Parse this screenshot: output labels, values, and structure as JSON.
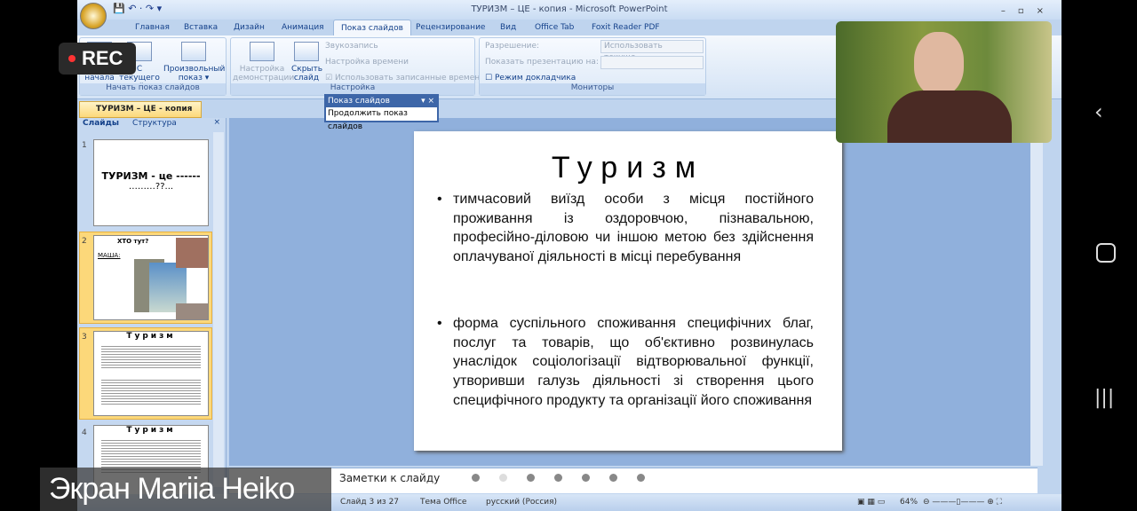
{
  "window": {
    "title": "ТУРИЗМ – ЦЕ - копия - Microsoft PowerPoint"
  },
  "tabs": [
    "Главная",
    "Вставка",
    "Дизайн",
    "Анимация",
    "Показ слайдов",
    "Рецензирование",
    "Вид",
    "Office Tab",
    "Foxit Reader PDF"
  ],
  "active_tab": "Показ слайдов",
  "ribbon": {
    "start_group": {
      "label": "Начать показ слайдов",
      "from_start": "С\nначала",
      "from_current": "С текущего слайда",
      "custom": "Произвольный показ ▾"
    },
    "setup_group": {
      "label": "Настройка",
      "setup": "Настройка демонстрации",
      "hide": "Скрыть слайд",
      "record": "Звукозапись",
      "timing": "Настройка времени",
      "use_timings": "Использовать записанные времена",
      "use_timings_checked": true
    },
    "monitors_group": {
      "label": "Мониторы",
      "resolution": "Разрешение:",
      "resolution_value": "Использовать текуще...",
      "show_on": "Показать презентацию на:",
      "presenter": "Режим докладчика",
      "presenter_checked": false
    }
  },
  "doc_tab": "ТУРИЗМ – ЦЕ - копия",
  "popup": {
    "title": "Показ слайдов",
    "item": "Продолжить показ слайдов"
  },
  "left_panel": {
    "tabs": [
      "Слайды",
      "Структура"
    ],
    "thumbs": [
      {
        "num": "1",
        "line1": "ТУРИЗМ - це ------",
        "line2": "………??..."
      },
      {
        "num": "2",
        "title": "ХТО тут?",
        "sub": "МАША:"
      },
      {
        "num": "3",
        "title": "Туризм"
      },
      {
        "num": "4",
        "title": "Туризм"
      }
    ]
  },
  "slide": {
    "title": "Туризм",
    "bullets": [
      "тимчасовий виїзд особи з місця постійного проживання із оздоровчою, пізнавальною, професійно-діловою чи іншою метою без здійснення оплачуваної діяльності в місці перебування",
      "форма суспільного споживання специфічних благ, послуг та товарів, що об'єктивно розвинулась унаслідок соціологізації відтворювальної функції, утворивши галузь діяльності зі створення цього специфічного продукту та організації його споживання"
    ]
  },
  "notes_placeholder": "Заметки к слайду",
  "status": {
    "slide": "Слайд 3 из 27",
    "theme": "Тема Office",
    "lang": "русский (Россия)",
    "zoom": "64%"
  },
  "overlay": {
    "rec": "REC",
    "caption": "Экран Mariia Heiko"
  }
}
